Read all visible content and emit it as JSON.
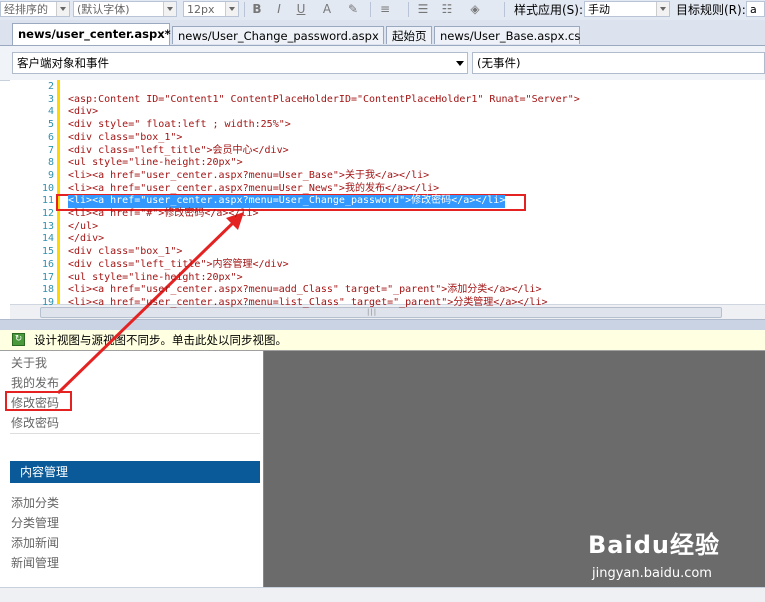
{
  "toolbar": {
    "block_format_partial": "经排序的",
    "font_name": "(默认字体)",
    "font_size": "12px",
    "bold": "B",
    "italic": "I",
    "underline": "U",
    "style_apply_label": "样式应用(S):",
    "style_apply_value": "手动",
    "target_rule_label": "目标规则(R):",
    "target_rule_value": "a"
  },
  "tabs": [
    {
      "label": "news/user_center.aspx*",
      "active": true
    },
    {
      "label": "news/User_Change_password.aspx",
      "active": false
    },
    {
      "label": "起始页",
      "active": false
    },
    {
      "label": "news/User_Base.aspx.cs",
      "active": false
    }
  ],
  "editor_dropdowns": {
    "left": "客户端对象和事件",
    "right": "(无事件)"
  },
  "code": {
    "line_numbers": [
      "2",
      "3",
      "4",
      "5",
      "6",
      "7",
      "8",
      "9",
      "10",
      "11",
      "12",
      "13",
      "14",
      "15",
      "16",
      "17",
      "18",
      "19"
    ],
    "lines": [
      "",
      "<asp:Content ID=\"Content1\" ContentPlaceHolderID=\"ContentPlaceHolder1\" Runat=\"Server\">",
      "<div>",
      "<div style=\" float:left ; width:25%\">",
      "<div class=\"box_1\">",
      "<div class=\"left_title\">会员中心</div>",
      "<ul style=\"line-height:20px\">",
      "<li><a href=\"user_center.aspx?menu=User_Base\">关于我</a></li>",
      "<li><a href=\"user_center.aspx?menu=User_News\">我的发布</a></li>",
      "<li><a href=\"user_center.aspx?menu=User_Change_password\">修改密码</a></li>",
      "<li><a href=\"#\">修改密码</a></li>",
      "</ul>",
      "</div>",
      "<div class=\"box_1\">",
      "<div class=\"left_title\">内容管理</div>",
      "<ul style=\"line-height:20px\">",
      "<li><a href=\"user_center.aspx?menu=add_Class\" target=\"_parent\">添加分类</a></li>",
      "<li><a href=\"user_center.aspx?menu=list_Class\" target=\"_parent\">分类管理</a></li>"
    ],
    "selected_index": 9
  },
  "infobar": {
    "message": "设计视图与源视图不同步。单击此处以同步视图。"
  },
  "design": {
    "member_links": [
      "关于我",
      "我的发布",
      "修改密码",
      "修改密码"
    ],
    "content_header": "内容管理",
    "content_links": [
      "添加分类",
      "分类管理",
      "添加新闻",
      "新闻管理"
    ]
  },
  "watermark": {
    "logo": "Baidu经验",
    "url": "jingyan.baidu.com"
  },
  "colors": {
    "selection": "#3399ff",
    "annotation": "#e52222",
    "nav_header": "#0a5a9a",
    "line_number": "#2b91af"
  }
}
